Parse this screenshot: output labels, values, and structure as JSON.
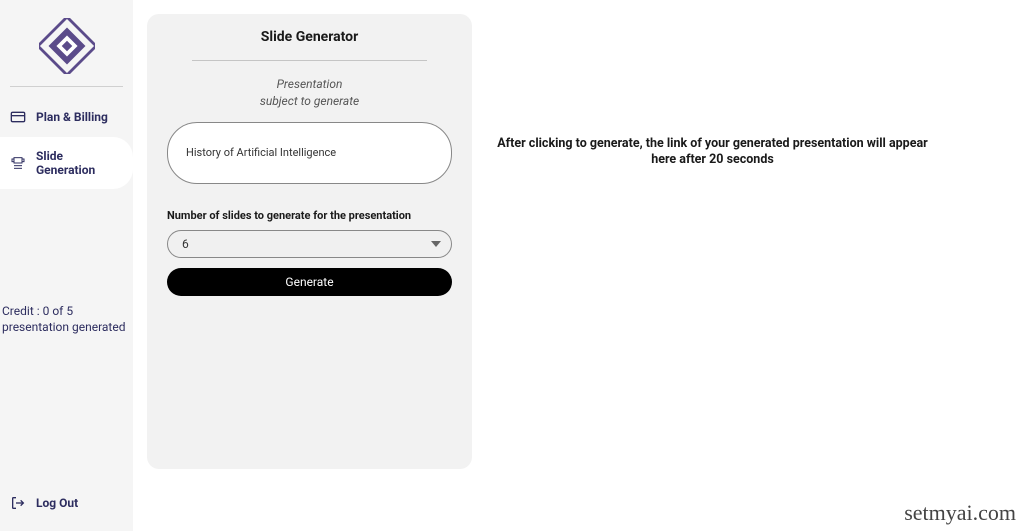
{
  "sidebar": {
    "nav": {
      "plan_billing": "Plan & Billing",
      "slide_generation": "Slide  Generation"
    },
    "credit_text": "Credit : 0 of 5 presentation generated",
    "logout": "Log Out"
  },
  "card": {
    "title": "Slide Generator",
    "subtitle_line1": "Presentation",
    "subtitle_line2": "subject to generate",
    "subject_value": "History of Artificial Intelligence",
    "slides_label": "Number of  slides to generate for the presentation",
    "slides_value": "6",
    "generate_label": "Generate"
  },
  "info_message": "After clicking to generate, the link of your generated presentation will appear here after 20 seconds",
  "watermark": "setmyai.com"
}
